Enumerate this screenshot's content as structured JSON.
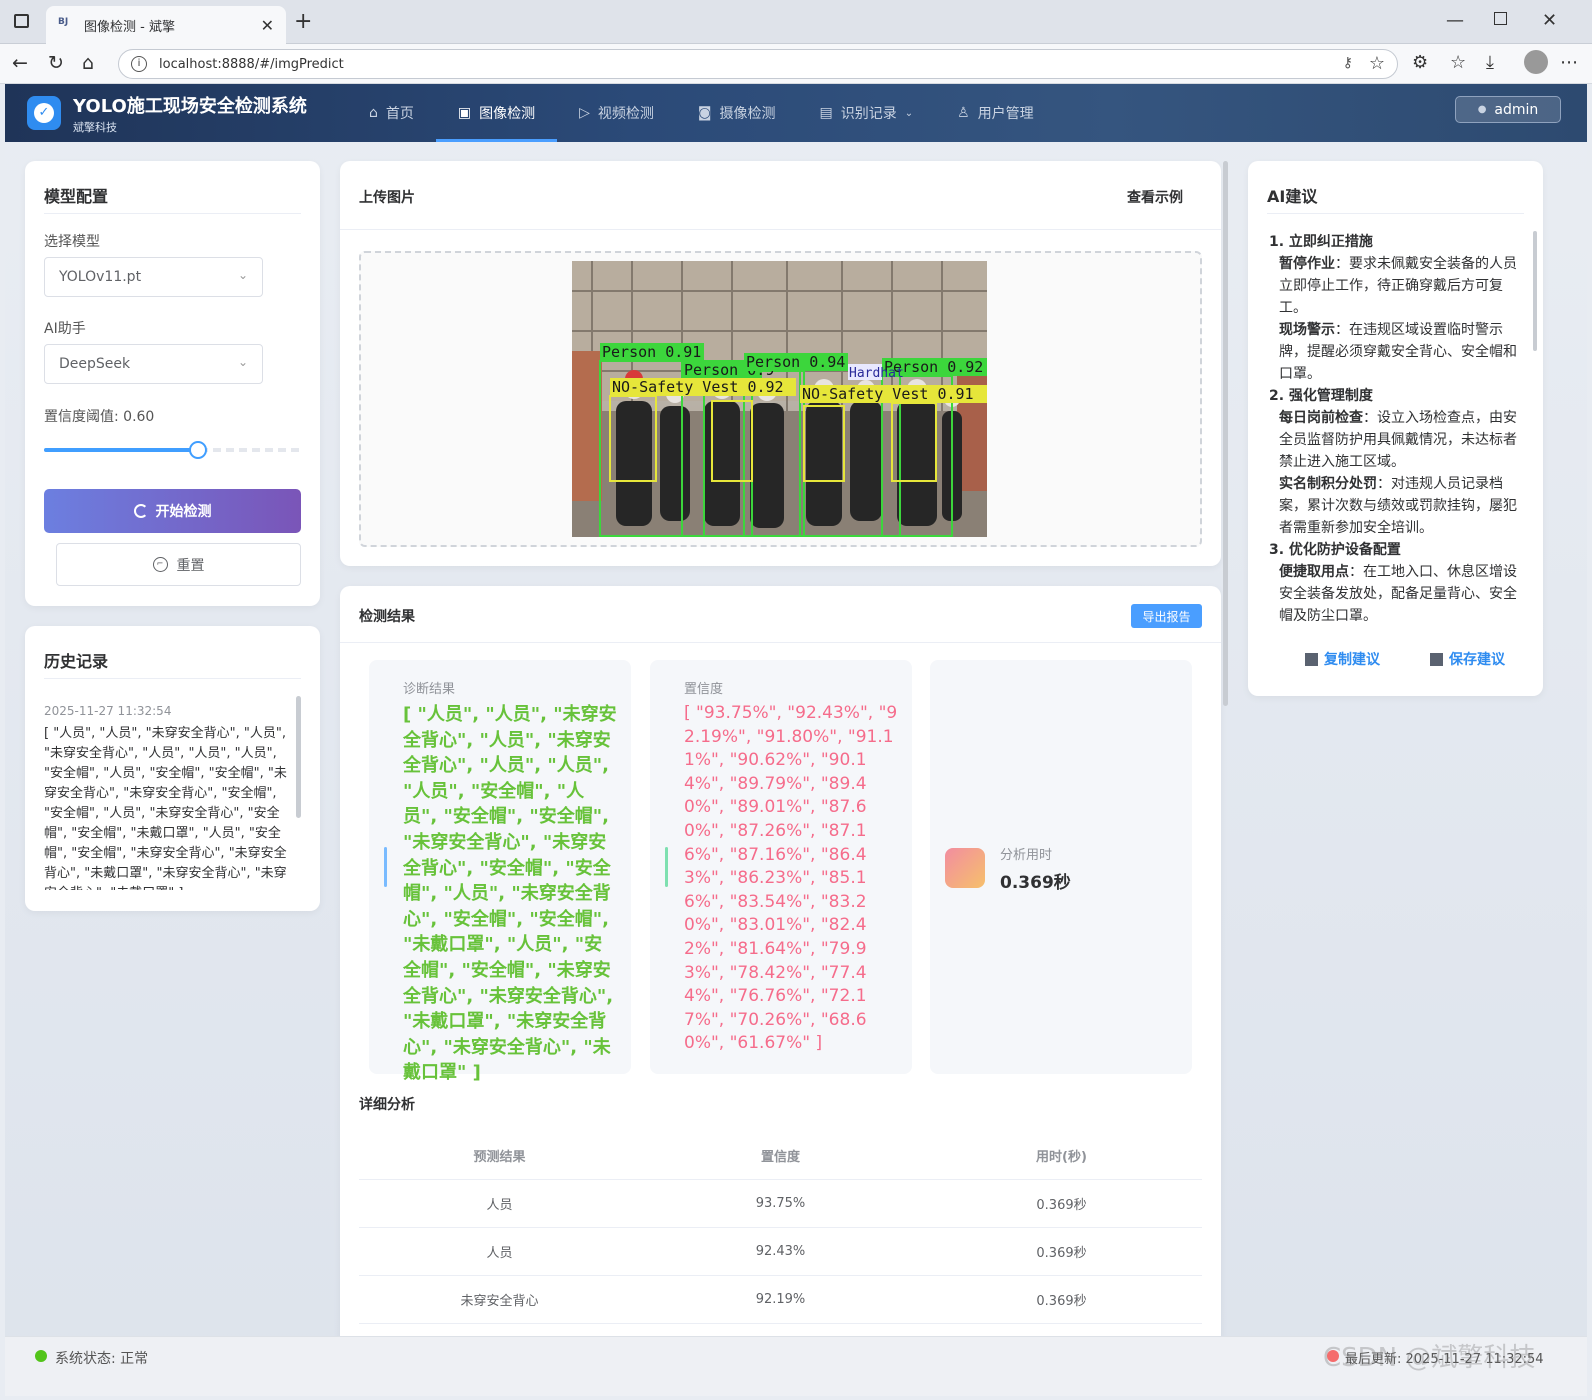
{
  "browser": {
    "tab_title": "图像检测 - 斌擎",
    "tab_favicon": "BJ",
    "url": "localhost:8888/#/imgPredict"
  },
  "header": {
    "title": "YOLO施工现场安全检测系统",
    "subtitle": "斌擎科技",
    "menu": [
      {
        "label": "首页",
        "icon": "home-icon"
      },
      {
        "label": "图像检测",
        "icon": "image-icon",
        "active": true
      },
      {
        "label": "视频检测",
        "icon": "play-icon"
      },
      {
        "label": "摄像检测",
        "icon": "camera-icon"
      },
      {
        "label": "识别记录",
        "icon": "document-icon",
        "dropdown": true
      },
      {
        "label": "用户管理",
        "icon": "user-icon"
      }
    ],
    "user": "admin"
  },
  "model_config": {
    "title": "模型配置",
    "model_label": "选择模型",
    "model_value": "YOLOv11.pt",
    "ai_label": "AI助手",
    "ai_value": "DeepSeek",
    "threshold_label": "置信度阈值: 0.60",
    "threshold_value": 0.6,
    "start_button": "开始检测",
    "reset_button": "重置"
  },
  "history": {
    "title": "历史记录",
    "time": "2025-11-27 11:32:54",
    "text": "[ \"人员\", \"人员\", \"未穿安全背心\", \"人员\", \"未穿安全背心\", \"人员\", \"人员\", \"人员\", \"安全帽\", \"人员\", \"安全帽\", \"安全帽\", \"未穿安全背心\", \"未穿安全背心\", \"安全帽\", \"安全帽\", \"人员\", \"未穿安全背心\", \"安全帽\", \"安全帽\", \"未戴口罩\", \"人员\", \"安全帽\", \"安全帽\", \"未穿安全背心\", \"未穿安全背心\", \"未戴口罩\", \"未穿安全背心\", \"未穿安全背心\", \"未戴口罩\" ]"
  },
  "upload": {
    "title": "上传图片",
    "example_link": "查看示例",
    "detections": [
      {
        "label": "Person 0.91"
      },
      {
        "label": "Person 0.9"
      },
      {
        "label": "Person 0.94"
      },
      {
        "label": "Person 0.92"
      },
      {
        "label": "NO-Safety Vest 0.92"
      },
      {
        "label": "NO-Safety Vest 0.91"
      },
      {
        "label": "Hardhat"
      }
    ]
  },
  "results": {
    "title": "检测结果",
    "export_button": "导出报告",
    "diagnosis_label": "诊断结果",
    "diagnosis_value": "[ \"人员\", \"人员\", \"未穿安全背心\", \"人员\", \"未穿安全背心\", \"人员\", \"人员\", \"人员\", \"安全帽\", \"人员\", \"安全帽\", \"安全帽\", \"未穿安全背心\", \"未穿安全背心\", \"安全帽\", \"安全帽\", \"人员\", \"未穿安全背心\", \"安全帽\", \"安全帽\", \"未戴口罩\", \"人员\", \"安全帽\", \"安全帽\", \"未穿安全背心\", \"未穿安全背心\", \"未戴口罩\", \"未穿安全背心\", \"未穿安全背心\", \"未戴口罩\" ]",
    "confidence_label": "置信度",
    "confidence_value": "[ \"93.75%\", \"92.43%\", \"92.19%\", \"91.80%\", \"91.11%\", \"90.62%\", \"90.14%\", \"89.79%\", \"89.40%\", \"89.01%\", \"87.60%\", \"87.26%\", \"87.16%\", \"87.16%\", \"86.43%\", \"86.23%\", \"85.16%\", \"83.54%\", \"83.20%\", \"83.01%\", \"82.42%\", \"81.64%\", \"79.93%\", \"78.42%\", \"77.44%\", \"76.76%\", \"72.17%\", \"70.26%\", \"68.60%\", \"61.67%\" ]",
    "time_label": "分析用时",
    "time_value": "0.369秒",
    "colors": {
      "diagnosis": "#67c23a",
      "confidence": "#f56c8b",
      "diag_bar": "#79bbff",
      "conf_bar": "#7ee0b0"
    }
  },
  "detail": {
    "title": "详细分析",
    "columns": [
      "预测结果",
      "置信度",
      "用时(秒)"
    ],
    "rows": [
      [
        "人员",
        "93.75%",
        "0.369秒"
      ],
      [
        "人员",
        "92.43%",
        "0.369秒"
      ],
      [
        "未穿安全背心",
        "92.19%",
        "0.369秒"
      ]
    ]
  },
  "ai_advice": {
    "title": "AI建议",
    "sections": [
      {
        "heading": "1. 立即纠正措施",
        "items": [
          {
            "k": "暂停作业",
            "v": "：要求未佩戴安全装备的人员立即停止工作，待正确穿戴后方可复工。"
          },
          {
            "k": "现场警示",
            "v": "：在违规区域设置临时警示牌，提醒必须穿戴安全背心、安全帽和口罩。"
          }
        ]
      },
      {
        "heading": "2. 强化管理制度",
        "items": [
          {
            "k": "每日岗前检查",
            "v": "：设立入场检查点，由安全员监督防护用具佩戴情况，未达标者禁止进入施工区域。"
          },
          {
            "k": "实名制积分处罚",
            "v": "：对违规人员记录档案，累计次数与绩效或罚款挂钩，屡犯者需重新参加安全培训。"
          }
        ]
      },
      {
        "heading": "3. 优化防护设备配置",
        "items": [
          {
            "k": "便捷取用点",
            "v": "：在工地入口、休息区增设安全装备发放处，配备足量背心、安全帽及防尘口罩。"
          }
        ]
      }
    ],
    "copy_button": "复制建议",
    "save_button": "保存建议"
  },
  "status": {
    "system": "系统状态: 正常",
    "updated": "最后更新: 2025-11-27 11:32:54",
    "watermark": "CSDN @斌擎科技"
  }
}
